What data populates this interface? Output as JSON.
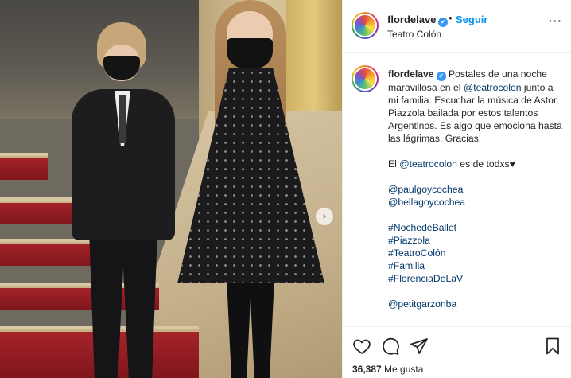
{
  "post": {
    "username": "flordelave",
    "verified_glyph": "✔",
    "dot": "•",
    "follow_label": "Seguir",
    "location": "Teatro Colón",
    "more_label": "···",
    "carousel_next": "›"
  },
  "caption": {
    "username": "flordelave",
    "line1_text": " Postales de una noche maravillosa en el ",
    "line1_mention": "@teatrocolon",
    "line1_rest": " junto a mi familia. Escuchar la música de Astor Piazzola bailada por estos talentos Argentinos. Es algo que emociona hasta las lágrimas. Gracias!",
    "line2_prefix": "El ",
    "line2_mention": "@teatrocolon",
    "line2_suffix": " es de todxs♥",
    "mentions": [
      "@paulgoycochea",
      "@bellagoycochea"
    ],
    "hashtags": [
      "#NochedeBallet",
      "#Piazzola",
      "#TeatroColón",
      "#Familia",
      "#FlorenciaDeLaV"
    ],
    "final_mention": "@petitgarzonba"
  },
  "actions": {
    "icons": [
      "heart-icon",
      "comment-icon",
      "share-icon",
      "bookmark-icon"
    ],
    "likes_count": "36,387",
    "likes_label": "Me gusta"
  },
  "colors": {
    "follow": "#0095f6",
    "link": "#00376b",
    "verified": "#3897f0",
    "text": "#262626"
  }
}
